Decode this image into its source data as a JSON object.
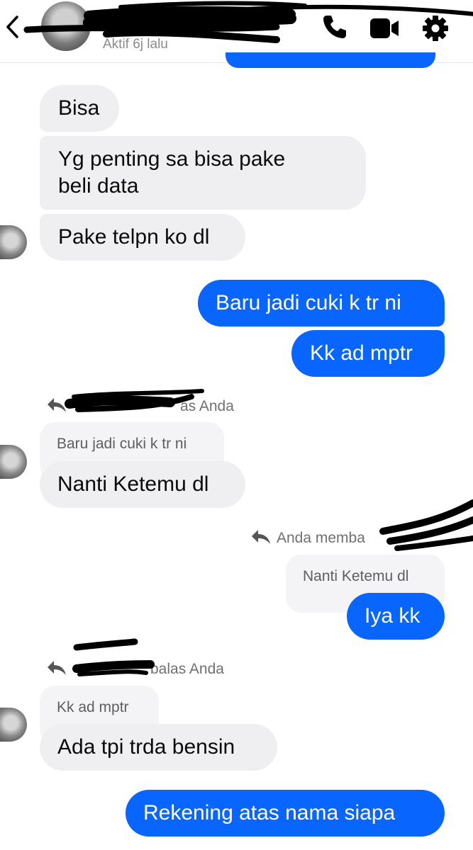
{
  "header": {
    "status": "Aktif 6j lalu"
  },
  "icons": {
    "back": "chevron-left-icon",
    "call": "phone-icon",
    "video": "video-camera-icon",
    "info": "gear-icon"
  },
  "colors": {
    "sent_bubble": "#0866ff",
    "received_bubble": "#efeff1"
  },
  "messages": [
    {
      "text": "Bisa"
    },
    {
      "text": "Yg penting sa bisa pake\nbeli data"
    },
    {
      "text": "Pake telpn ko dl"
    },
    {
      "text": "Baru jadi cuki k tr ni"
    },
    {
      "text": "Kk ad mptr"
    },
    {
      "reply_label": "as Anda",
      "quote": "Baru jadi cuki k tr ni",
      "text": "Nanti Ketemu dl"
    },
    {
      "reply_label": "Anda memba",
      "quote": "Nanti Ketemu dl",
      "text": "Iya kk"
    },
    {
      "reply_label": "balas Anda",
      "quote": "Kk ad mptr",
      "text": "Ada tpi trda bensin"
    },
    {
      "text": "Rekening atas nama siapa"
    }
  ]
}
